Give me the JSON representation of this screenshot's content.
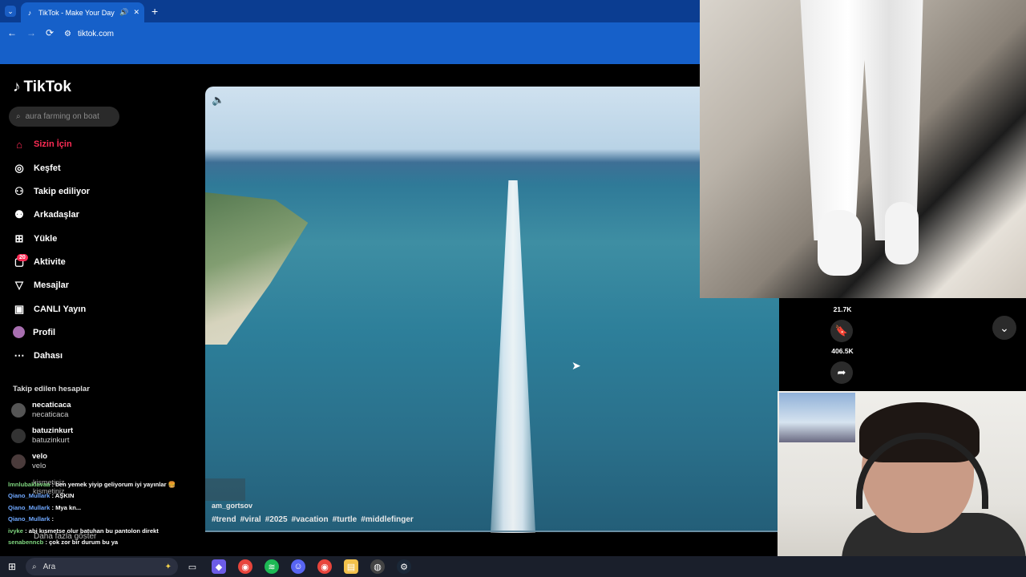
{
  "browser": {
    "tab_title": "TikTok - Make Your Day",
    "url": "tiktok.com",
    "icons": [
      "tab-menu-icon",
      "tiktok-favicon-icon",
      "speaker-icon",
      "close-icon",
      "plus-icon",
      "back-icon",
      "forward-icon",
      "reload-icon",
      "site-info-icon"
    ]
  },
  "app": {
    "name": "TikTok"
  },
  "search": {
    "placeholder": "aura farming on boat"
  },
  "nav": [
    {
      "label": "Sizin İçin",
      "icon": "home-icon",
      "active": true
    },
    {
      "label": "Keşfet",
      "icon": "compass-icon"
    },
    {
      "label": "Takip ediliyor",
      "icon": "following-icon"
    },
    {
      "label": "Arkadaşlar",
      "icon": "friends-icon"
    },
    {
      "label": "Yükle",
      "icon": "upload-icon"
    },
    {
      "label": "Aktivite",
      "icon": "activity-icon",
      "badge": "20"
    },
    {
      "label": "Mesajlar",
      "icon": "send-icon"
    },
    {
      "label": "CANLI Yayın",
      "icon": "live-icon"
    },
    {
      "label": "Profil",
      "icon": "profile-icon"
    },
    {
      "label": "Dahası",
      "icon": "more-icon"
    }
  ],
  "following": {
    "heading": "Takip edilen hesaplar",
    "accounts": [
      {
        "name": "necaticaca",
        "handle": "necaticaca"
      },
      {
        "name": "batuzinkurt",
        "handle": "batuzinkurt"
      },
      {
        "name": "velo",
        "handle": "velo"
      },
      {
        "name": "kismetiniz",
        "handle": "kismetiniz"
      }
    ],
    "show_more": "Daha fazla göster"
  },
  "video": {
    "author": "am_gortsov",
    "hashtags": [
      "#trend",
      "#viral",
      "#2025",
      "#vacation",
      "#turtle",
      "#middlefinger"
    ]
  },
  "actions": {
    "like_count": "21.7K",
    "save_count": "406.5K"
  },
  "chat": [
    {
      "user": "lmnlubaklavaa",
      "msg": ": ben yemek yiyip geliyorum iyi yayınlar 🍔"
    },
    {
      "user": "Qiano_Mullark",
      "msg": ": AŞKIN"
    },
    {
      "user": "Qiano_Mullark",
      "msg": ": Mya kn..."
    },
    {
      "user": "Qiano_Mullark",
      "msg": ":"
    },
    {
      "user": "ivyke",
      "msg": ": abi kısmetse olur batuhan bu pantolon direkt"
    },
    {
      "user": "senabenncb",
      "msg": ": çok zor bir durum bu ya"
    }
  ],
  "taskbar": {
    "search_label": "Ara"
  },
  "colors": {
    "accent": "#fe2c55",
    "chrome": "#1660c9"
  }
}
